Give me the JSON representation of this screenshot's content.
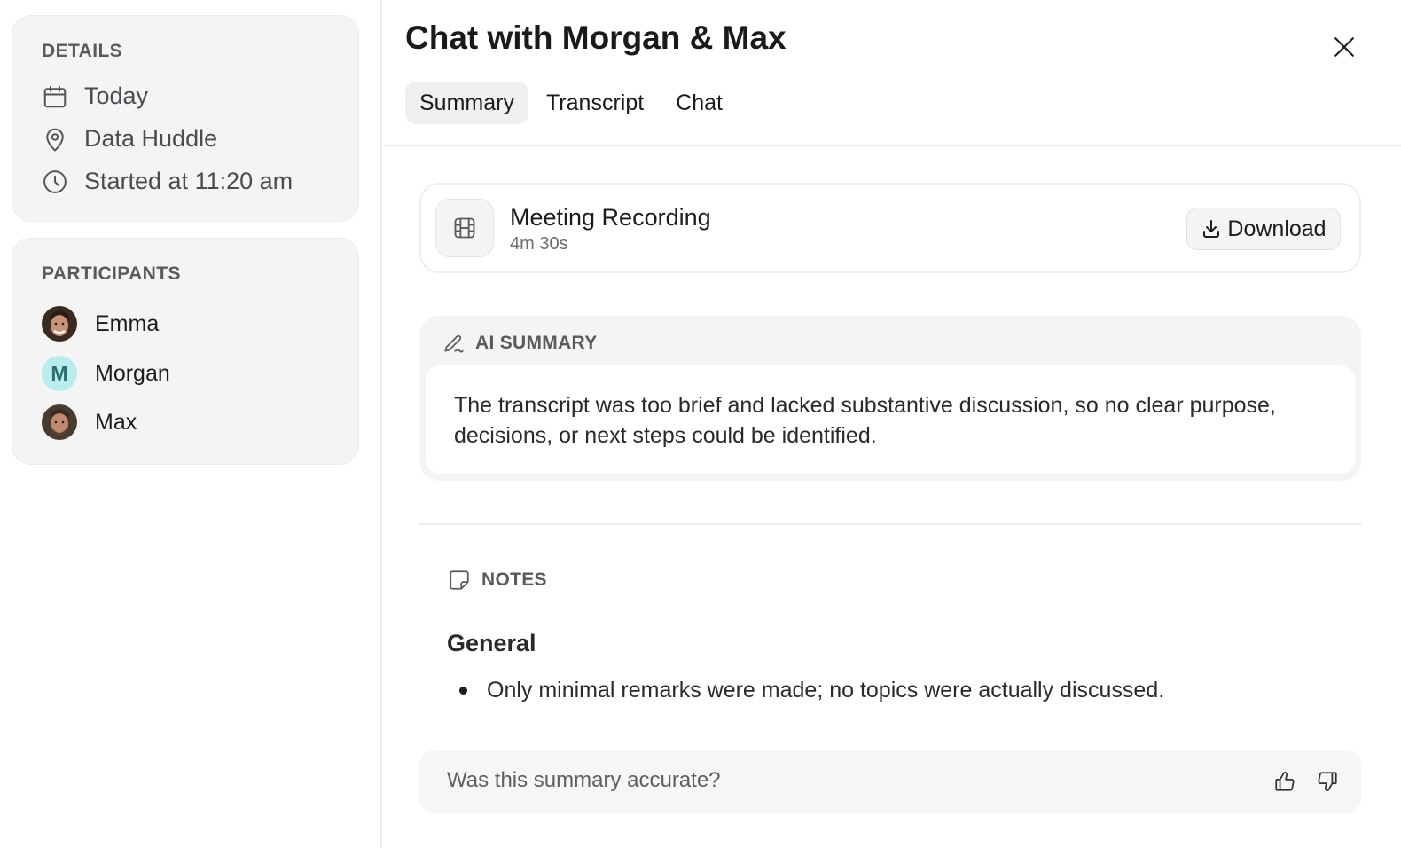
{
  "sidebar": {
    "details": {
      "title": "DETAILS",
      "date": "Today",
      "location": "Data Huddle",
      "started": "Started at 11:20 am"
    },
    "participants": {
      "title": "PARTICIPANTS",
      "list": [
        {
          "name": "Emma",
          "avatar": "photo"
        },
        {
          "name": "Morgan",
          "avatar": "letter",
          "initial": "M",
          "color": "#b9ecec"
        },
        {
          "name": "Max",
          "avatar": "photo"
        }
      ]
    }
  },
  "header": {
    "title": "Chat with Morgan & Max",
    "close_icon": "close-icon",
    "tabs": [
      {
        "label": "Summary",
        "active": true
      },
      {
        "label": "Transcript",
        "active": false
      },
      {
        "label": "Chat",
        "active": false
      }
    ]
  },
  "recording": {
    "title": "Meeting Recording",
    "duration": "4m 30s",
    "icon": "film-icon",
    "download_label": "Download"
  },
  "ai_summary": {
    "label": "AI SUMMARY",
    "icon": "pen-icon",
    "text": "The transcript was too brief and lacked substantive discussion, so no clear purpose, decisions, or next steps could be identified."
  },
  "notes": {
    "label": "NOTES",
    "icon": "note-icon",
    "heading": "General",
    "items": [
      "Only minimal remarks were made; no topics were actually discussed."
    ]
  },
  "feedback": {
    "question": "Was this summary accurate?",
    "up_icon": "thumbs-up-icon",
    "down_icon": "thumbs-down-icon"
  }
}
